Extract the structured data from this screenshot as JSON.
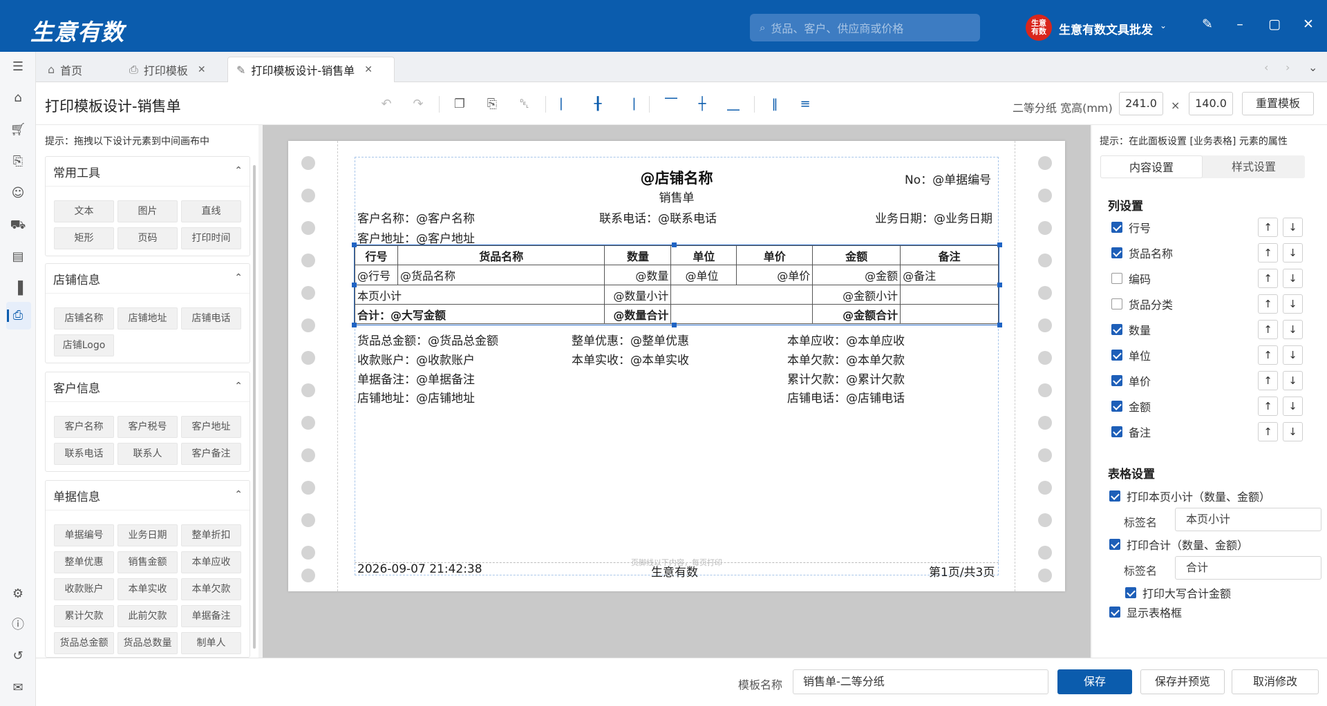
{
  "app": {
    "logo": "生意有数",
    "search_placeholder": "货品、客户、供应商或价格",
    "shop_avatar_text": "生意有数",
    "shop_name": "生意有数文具批发"
  },
  "tabs": [
    {
      "label": "首页",
      "icon": "home-icon"
    },
    {
      "label": "打印模板",
      "icon": "printer-icon"
    },
    {
      "label": "打印模板设计-销售单",
      "icon": "edit-icon"
    }
  ],
  "page": {
    "title": "打印模板设计-销售单",
    "paper_label": "二等分纸 宽高(mm)",
    "width": "241.0",
    "times": "×",
    "height": "140.0",
    "reset_label": "重置模板"
  },
  "left_panel": {
    "hint": "提示：拖拽以下设计元素到中间画布中",
    "groups": [
      {
        "title": "常用工具",
        "items": [
          "文本",
          "图片",
          "直线",
          "矩形",
          "页码",
          "打印时间"
        ]
      },
      {
        "title": "店铺信息",
        "items": [
          "店铺名称",
          "店铺地址",
          "店铺电话",
          "店铺Logo"
        ]
      },
      {
        "title": "客户信息",
        "items": [
          "客户名称",
          "客户税号",
          "客户地址",
          "联系电话",
          "联系人",
          "客户备注"
        ]
      },
      {
        "title": "单据信息",
        "items": [
          "单据编号",
          "业务日期",
          "整单折扣",
          "整单优惠",
          "销售金额",
          "本单应收",
          "收款账户",
          "本单实收",
          "本单欠款",
          "累计欠款",
          "此前欠款",
          "单据备注",
          "货品总金额",
          "货品总数量",
          "制单人"
        ]
      }
    ]
  },
  "paper": {
    "shop_name": "@店铺名称",
    "doc_no": "No：@单据编号",
    "doc_type": "销售单",
    "customer_name": "客户名称：@客户名称",
    "contact_phone": "联系电话：@联系电话",
    "biz_date": "业务日期：@业务日期",
    "customer_addr": "客户地址：@客户地址",
    "table": {
      "headers": [
        "行号",
        "货品名称",
        "数量",
        "单位",
        "单价",
        "金额",
        "备注"
      ],
      "item_row": [
        "@行号",
        "@货品名称",
        "@数量",
        "@单位",
        "@单价",
        "@金额",
        "@备注"
      ],
      "subtotal_label": "本页小计",
      "subtotal_qty": "@数量小计",
      "subtotal_amount": "@金额小计",
      "total_label": "合计：@大写金额",
      "total_qty": "@数量合计",
      "total_amount": "@金额合计"
    },
    "summary": [
      [
        "货品总金额：@货品总金额",
        "整单优惠：@整单优惠",
        "本单应收：@本单应收"
      ],
      [
        "收款账户：@收款账户",
        "本单实收：@本单实收",
        "本单欠款：@本单欠款"
      ],
      [
        "单据备注：@单据备注",
        "",
        "累计欠款：@累计欠款"
      ],
      [
        "店铺地址：@店铺地址",
        "",
        "店铺电话：@店铺电话"
      ]
    ],
    "footer_hint": "页脚线以下内容，每页打印",
    "print_time": "2026-09-07 21:42:38",
    "footer_center": "生意有数",
    "page_no": "第1页/共3页"
  },
  "right_panel": {
    "hint": "提示：在此面板设置 [业务表格] 元素的属性",
    "tabs": [
      "内容设置",
      "样式设置"
    ],
    "columns_title": "列设置",
    "columns": [
      {
        "label": "行号",
        "checked": true
      },
      {
        "label": "货品名称",
        "checked": true
      },
      {
        "label": "编码",
        "checked": false
      },
      {
        "label": "货品分类",
        "checked": false
      },
      {
        "label": "数量",
        "checked": true
      },
      {
        "label": "单位",
        "checked": true
      },
      {
        "label": "单价",
        "checked": true
      },
      {
        "label": "金额",
        "checked": true
      },
      {
        "label": "备注",
        "checked": true
      }
    ],
    "up_label": "↑",
    "down_label": "↓",
    "table_title": "表格设置",
    "print_subtotal": "打印本页小计（数量、金额）",
    "tag_label": "标签名",
    "subtotal_tag": "本页小计",
    "print_total": "打印合计（数量、金额）",
    "total_tag": "合计",
    "print_uppercase": "打印大写合计金额",
    "show_border": "显示表格框"
  },
  "bottom": {
    "template_label": "模板名称",
    "template_name": "销售单-二等分纸",
    "save": "保存",
    "save_preview": "保存并预览",
    "cancel": "取消修改"
  },
  "colors": {
    "brand": "#0b5cad",
    "accent": "#1e5fb8",
    "avatar": "#d9261c"
  }
}
